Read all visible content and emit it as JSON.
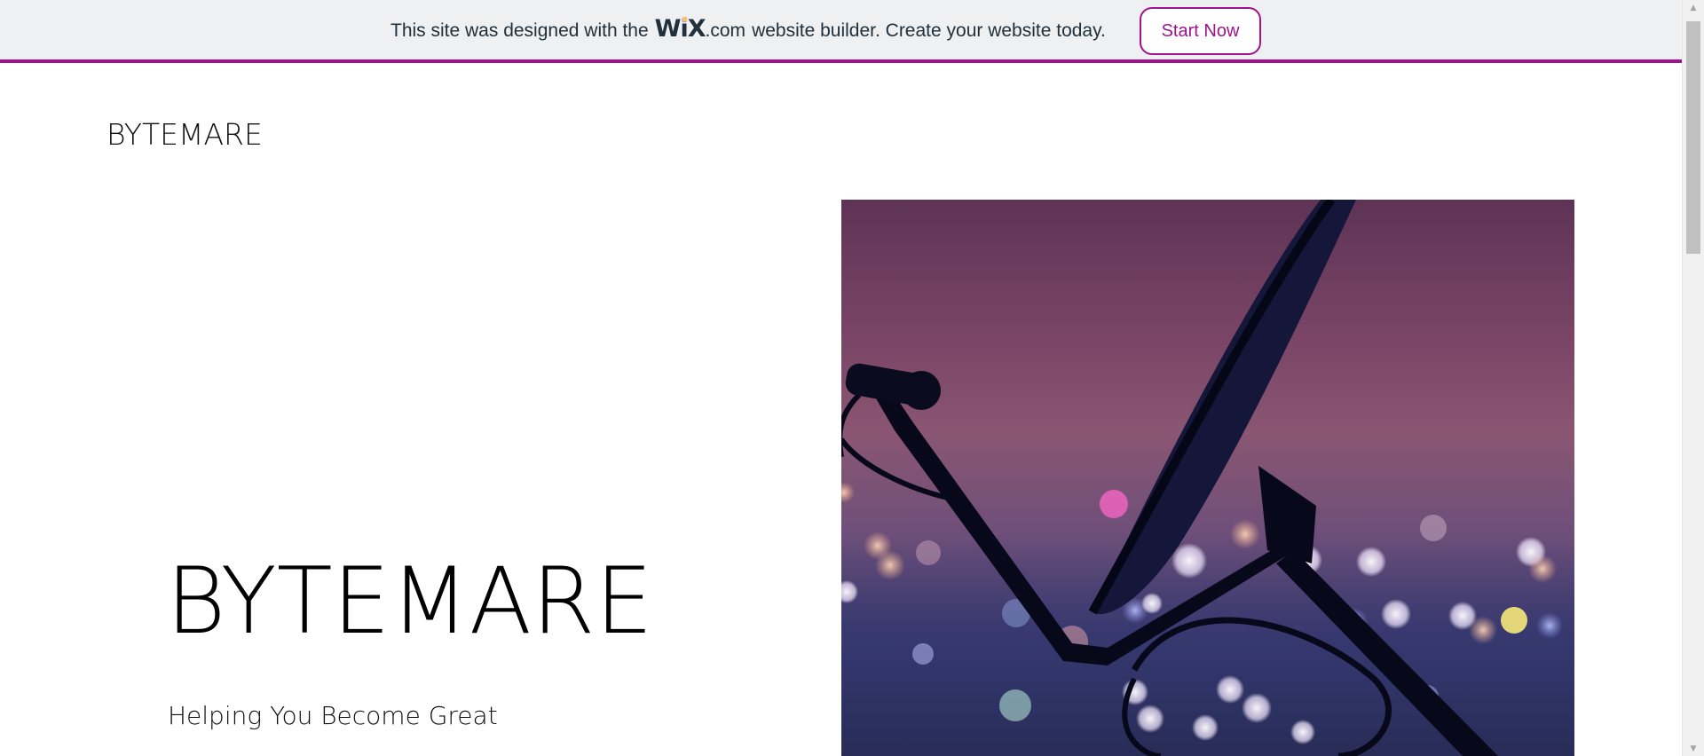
{
  "banner": {
    "text_before": "This site was designed with the",
    "logo_text_w": "W",
    "logo_text_i": "i",
    "logo_text_x": "X",
    "domain_suffix": ".com",
    "text_after": "website builder. Create your website today.",
    "cta_label": "Start Now",
    "accent_color": "#a0138e"
  },
  "site": {
    "logo": "BYTEMARE"
  },
  "hero": {
    "title": "BYTEMARE",
    "subtitle": "Helping You Become Great",
    "image_icon": "satellite-dish-photo"
  },
  "scrollbar": {
    "up_icon": "chevron-up-icon",
    "down_icon": "chevron-down-icon"
  }
}
